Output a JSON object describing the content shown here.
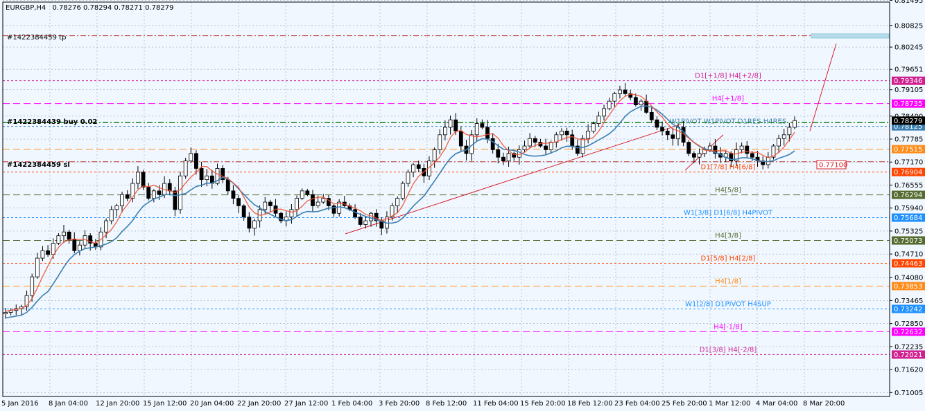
{
  "header": {
    "symbol": "EURGBP,H4",
    "ohlc": "0.78276 0.78294 0.78271 0.78279"
  },
  "order_labels": {
    "tp": "#1422384459 tp",
    "buy": "#1422384439 buy 0.02",
    "sl": "#1422384459 sl"
  },
  "current_price": "0.78279",
  "marker_price": "0.77100",
  "colors": {
    "background": "#f0f7ff",
    "up_candle": "#000000",
    "down_candle": "#000000",
    "ma_red": "#f05030",
    "ma_blue": "#3c7fb0",
    "trend": "#d8202a",
    "tp_box": "#b8dcea"
  },
  "chart_data": {
    "type": "candlestick",
    "y_axis": {
      "min": 0.709,
      "max": 0.8145,
      "tick_labels": [
        "0.81495",
        "0.80825",
        "0.80245",
        "0.79651",
        "0.79105",
        "0.78400",
        "0.77785",
        "0.77170",
        "0.76555",
        "0.75940",
        "0.75325",
        "0.74710",
        "0.74080",
        "0.73465",
        "0.72850",
        "0.72235",
        "0.71620",
        "0.71005"
      ]
    },
    "x_axis": {
      "labels": [
        "5 Jan 2016",
        "8 Jan 04:00",
        "12 Jan 20:00",
        "15 Jan 12:00",
        "20 Jan 04:00",
        "22 Jan 20:00",
        "27 Jan 12:00",
        "1 Feb 04:00",
        "3 Feb 20:00",
        "8 Feb 12:00",
        "11 Feb 04:00",
        "15 Feb 20:00",
        "18 Feb 12:00",
        "23 Feb 04:00",
        "25 Feb 20:00",
        "1 Mar 12:00",
        "4 Mar 04:00",
        "8 Mar 20:00"
      ]
    },
    "levels": [
      {
        "label": "D1[+1/8] H4[+2/8]",
        "price": "0.79346",
        "value": 0.79346,
        "color": "#d02090",
        "style": "dot"
      },
      {
        "label": "H4[+1/8]",
        "price": "0.78735",
        "value": 0.78735,
        "color": "#ff00ff",
        "style": "dash"
      },
      {
        "label": "W1PIVOT W1PIVOT D1RES H4RES",
        "price": "0.78125",
        "value": 0.78125,
        "color": "#3c7fb0",
        "style": "dot"
      },
      {
        "label": "",
        "price": "0.77515",
        "value": 0.77515,
        "color": "#ff8c1a",
        "style": "dash"
      },
      {
        "label": "D1[7/8] H4[6/8]",
        "price": "0.76904",
        "value": 0.76904,
        "color": "#ff4500",
        "style": "dot"
      },
      {
        "label": "H4[5/8]",
        "price": "0.76294",
        "value": 0.76294,
        "color": "#556b2f",
        "style": "dash"
      },
      {
        "label": "W1[3/8] D1[6/8] H4PIVOT",
        "price": "0.75684",
        "value": 0.75684,
        "color": "#1e90ff",
        "style": "dot"
      },
      {
        "label": "H4[3/8]",
        "price": "0.75073",
        "value": 0.75073,
        "color": "#556b2f",
        "style": "dash"
      },
      {
        "label": "D1[5/8] H4[2/8]",
        "price": "0.74463",
        "value": 0.74463,
        "color": "#ff4500",
        "style": "dot"
      },
      {
        "label": "H4[1/8]",
        "price": "0.73853",
        "value": 0.73853,
        "color": "#ff8c1a",
        "style": "dash"
      },
      {
        "label": "W1[2/8] D1PIVOT H4SUP",
        "price": "0.73242",
        "value": 0.73242,
        "color": "#1e90ff",
        "style": "dot"
      },
      {
        "label": "H4[-1/8]",
        "price": "0.72632",
        "value": 0.72632,
        "color": "#ff00ff",
        "style": "dash"
      },
      {
        "label": "D1[3/8] H4[-2/8]",
        "price": "0.72021",
        "value": 0.72021,
        "color": "#d02090",
        "style": "dot"
      }
    ],
    "order_lines": {
      "tp": 0.8055,
      "buy": 0.7823,
      "sl": 0.7718
    },
    "closes": [
      0.7315,
      0.732,
      0.7325,
      0.733,
      0.736,
      0.741,
      0.746,
      0.748,
      0.747,
      0.75,
      0.752,
      0.753,
      0.751,
      0.748,
      0.7495,
      0.752,
      0.75,
      0.749,
      0.753,
      0.756,
      0.759,
      0.76,
      0.763,
      0.762,
      0.766,
      0.769,
      0.765,
      0.762,
      0.764,
      0.763,
      0.766,
      0.764,
      0.759,
      0.768,
      0.772,
      0.774,
      0.77,
      0.767,
      0.768,
      0.766,
      0.77,
      0.767,
      0.764,
      0.762,
      0.76,
      0.757,
      0.754,
      0.756,
      0.759,
      0.761,
      0.76,
      0.758,
      0.756,
      0.757,
      0.759,
      0.762,
      0.764,
      0.763,
      0.76,
      0.761,
      0.762,
      0.76,
      0.758,
      0.761,
      0.76,
      0.759,
      0.757,
      0.755,
      0.756,
      0.758,
      0.756,
      0.754,
      0.757,
      0.76,
      0.762,
      0.766,
      0.769,
      0.771,
      0.77,
      0.768,
      0.772,
      0.775,
      0.779,
      0.781,
      0.783,
      0.78,
      0.776,
      0.774,
      0.779,
      0.782,
      0.781,
      0.778,
      0.775,
      0.773,
      0.772,
      0.774,
      0.773,
      0.775,
      0.776,
      0.778,
      0.777,
      0.776,
      0.775,
      0.777,
      0.779,
      0.78,
      0.779,
      0.776,
      0.774,
      0.778,
      0.78,
      0.782,
      0.784,
      0.786,
      0.788,
      0.79,
      0.791,
      0.79,
      0.789,
      0.787,
      0.788,
      0.785,
      0.783,
      0.781,
      0.78,
      0.779,
      0.778,
      0.781,
      0.777,
      0.774,
      0.773,
      0.774,
      0.775,
      0.776,
      0.774,
      0.773,
      0.774,
      0.772,
      0.775,
      0.776,
      0.774,
      0.773,
      0.772,
      0.771,
      0.773,
      0.776,
      0.778,
      0.779,
      0.781,
      0.7828
    ]
  }
}
